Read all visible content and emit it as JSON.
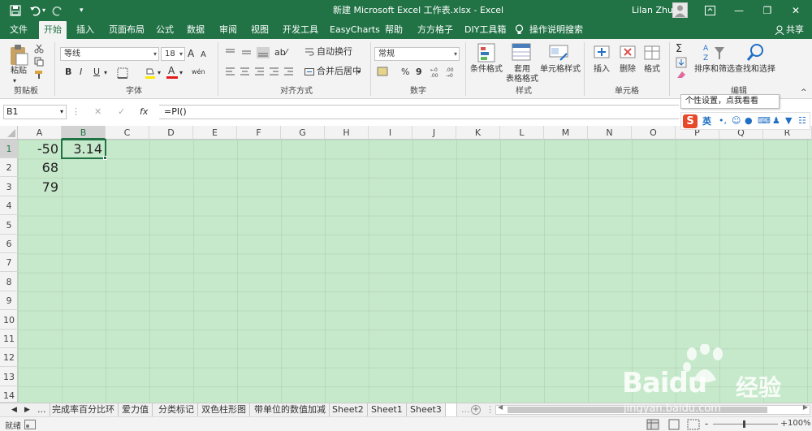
{
  "title_bar": {
    "qat": {
      "save_icon": "save-icon",
      "undo_icon": "undo-icon",
      "redo_icon": "redo-icon",
      "customize_icon": "chevron-down-icon"
    },
    "window_title": "新建 Microsoft Excel 工作表.xlsx - Excel",
    "user": "Lilan Zhu",
    "ribbon_display_icon": "ribbon-display-icon",
    "minimize": "—",
    "restore": "❐",
    "close": "✕"
  },
  "tabs": [
    {
      "label": "文件"
    },
    {
      "label": "开始"
    },
    {
      "label": "插入"
    },
    {
      "label": "页面布局"
    },
    {
      "label": "公式"
    },
    {
      "label": "数据"
    },
    {
      "label": "审阅"
    },
    {
      "label": "视图"
    },
    {
      "label": "开发工具"
    },
    {
      "label": "EasyCharts"
    },
    {
      "label": "帮助"
    },
    {
      "label": "方方格子"
    },
    {
      "label": "DIY工具箱"
    },
    {
      "label": "操作说明搜索"
    }
  ],
  "share_label": "共享",
  "ribbon": {
    "clipboard": {
      "paste": "粘贴",
      "group": "剪贴板"
    },
    "font": {
      "name": "等线",
      "size": "18",
      "bold": "B",
      "italic": "I",
      "underline": "U",
      "grow": "A",
      "shrink": "A",
      "group": "字体",
      "wen": "wén"
    },
    "alignment": {
      "wrap": "自动换行",
      "merge": "合并后居中",
      "group": "对齐方式"
    },
    "number": {
      "format": "常规",
      "percent": "%",
      "comma": "9",
      "group": "数字"
    },
    "styles": {
      "conditional": "条件格式",
      "table_line1": "套用",
      "table_line2": "表格格式",
      "cell_styles": "单元格样式",
      "group": "样式"
    },
    "cells": {
      "insert": "插入",
      "delete": "删除",
      "format": "格式",
      "group": "单元格"
    },
    "editing": {
      "sort": "排序和筛选",
      "find": "查找和选择",
      "group": "编辑"
    }
  },
  "formula_bar": {
    "name_box": "B1",
    "cancel": "✕",
    "enter": "✓",
    "fx": "fx",
    "formula": "=PI()"
  },
  "tooltip": "个性设置，点我看看",
  "ime": {
    "logo": "S",
    "lang": "英"
  },
  "columns": [
    "A",
    "B",
    "C",
    "D",
    "E",
    "F",
    "G",
    "H",
    "I",
    "J",
    "K",
    "L",
    "M",
    "N",
    "O",
    "P",
    "Q",
    "R"
  ],
  "rows": [
    "1",
    "2",
    "3",
    "4",
    "5",
    "6",
    "7",
    "8",
    "9",
    "10",
    "11",
    "12",
    "13",
    "14"
  ],
  "cells": [
    {
      "ref": "A1",
      "value": "-50"
    },
    {
      "ref": "B1",
      "value": "3.14"
    },
    {
      "ref": "A2",
      "value": "68"
    },
    {
      "ref": "A3",
      "value": "79"
    }
  ],
  "sheet_tabs": [
    "...",
    "完成率百分比环",
    "爱力值",
    "分类标记",
    "双色柱形图",
    "带单位的数值加减",
    "Sheet2",
    "Sheet1",
    "Sheet3"
  ],
  "status": {
    "mode": "就绪",
    "zoom": "100%",
    "minus": "-",
    "plus": "+"
  },
  "watermark": {
    "brand": "Baidu",
    "cn": "经验",
    "url": "jingyan.baidu.com"
  }
}
